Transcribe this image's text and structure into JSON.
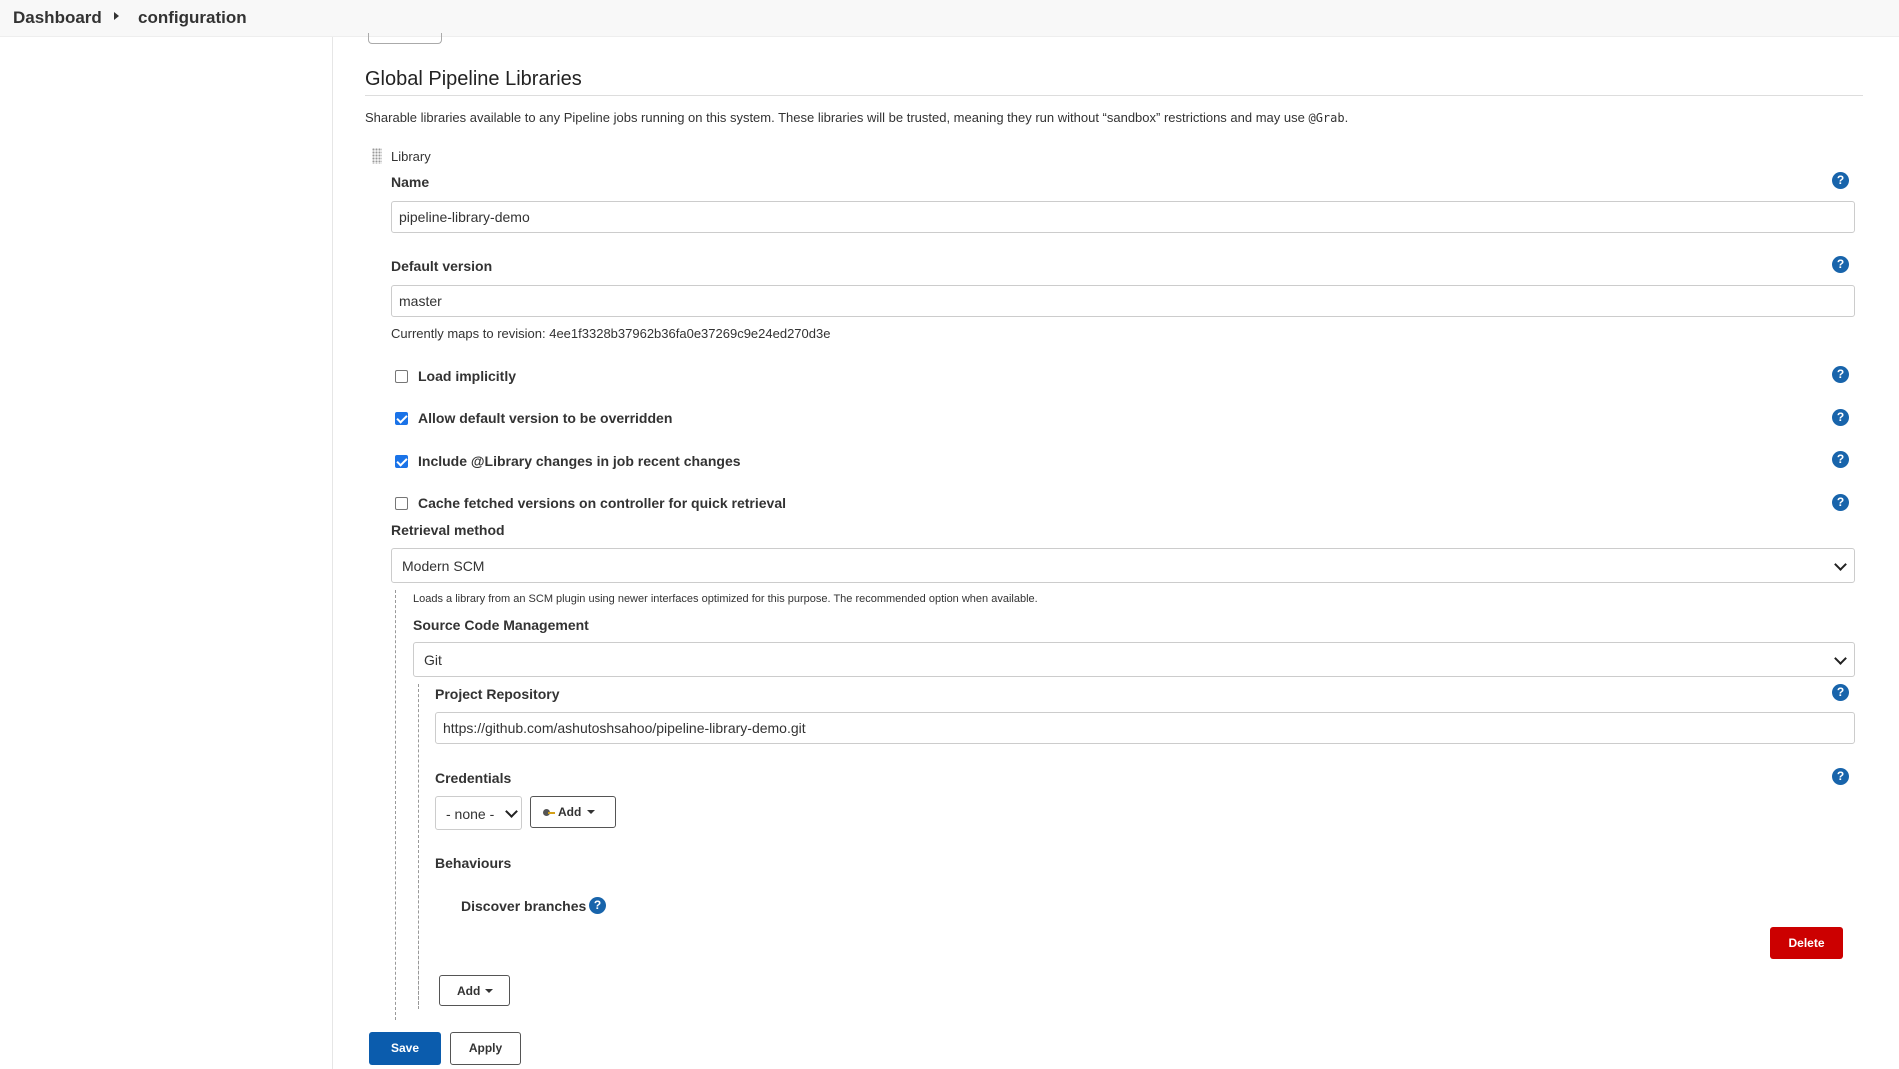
{
  "breadcrumb": {
    "dashboard": "Dashboard",
    "current": "configuration"
  },
  "section": {
    "title": "Global Pipeline Libraries",
    "description": "Sharable libraries available to any Pipeline jobs running on this system. These libraries will be trusted, meaning they run without “sandbox” restrictions and may use ",
    "description_code": "@Grab",
    "description_end": "."
  },
  "library": {
    "header": "Library",
    "name_label": "Name",
    "name_value": "pipeline-library-demo",
    "default_version_label": "Default version",
    "default_version_value": "master",
    "revision_text": "Currently maps to revision: 4ee1f3328b37962b36fa0e37269c9e24ed270d3e",
    "options": [
      {
        "label": "Load implicitly",
        "checked": false
      },
      {
        "label": "Allow default version to be overridden",
        "checked": true
      },
      {
        "label": "Include @Library changes in job recent changes",
        "checked": true
      },
      {
        "label": "Cache fetched versions on controller for quick retrieval",
        "checked": false
      }
    ],
    "retrieval_label": "Retrieval method",
    "retrieval_value": "Modern SCM",
    "retrieval_hint": "Loads a library from an SCM plugin using newer interfaces optimized for this purpose. The recommended option when available.",
    "scm_label": "Source Code Management",
    "scm_value": "Git",
    "repo_label": "Project Repository",
    "repo_value": "https://github.com/ashutoshsahoo/pipeline-library-demo.git",
    "credentials_label": "Credentials",
    "credentials_value": "- none -",
    "credentials_add": "Add",
    "behaviours_label": "Behaviours",
    "behaviour_item": "Discover branches",
    "delete_label": "Delete",
    "add_label": "Add"
  },
  "help_icon_glyph": "?",
  "colors": {
    "primary": "#0b5cad",
    "danger": "#cc0000",
    "help": "#1864ab",
    "checkbox": "#1a73e8"
  },
  "footer": {
    "save_label": "Save",
    "apply_label": "Apply"
  }
}
